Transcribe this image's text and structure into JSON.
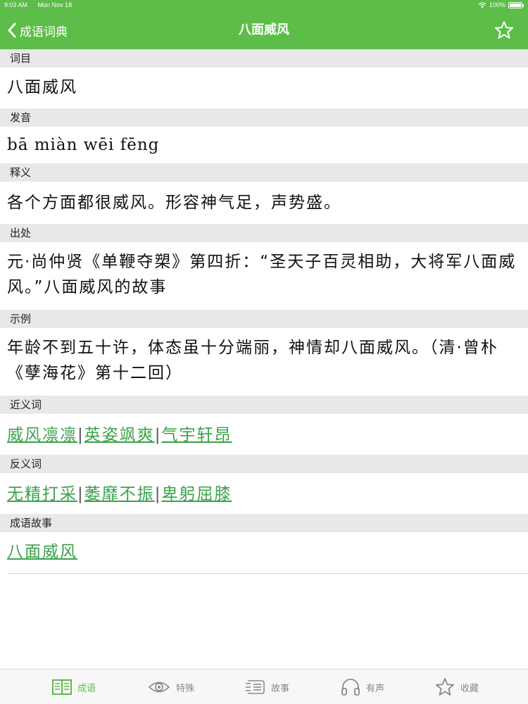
{
  "status": {
    "time": "9:03 AM",
    "date": "Mon Nov 18",
    "battery": "100%"
  },
  "nav": {
    "back_label": "成语词典",
    "title": "八面威风"
  },
  "sections": {
    "term": {
      "heading": "词目",
      "text": "八面威风"
    },
    "pinyin": {
      "heading": "发音",
      "text": "bā miàn wēi fēng"
    },
    "meaning": {
      "heading": "释义",
      "text": "各个方面都很威风。形容神气足，声势盛。"
    },
    "source": {
      "heading": "出处",
      "text": "元·尚仲贤《单鞭夺槊》第四折：“圣天子百灵相助，大将军八面威风。”八面威风的故事"
    },
    "example": {
      "heading": "示例",
      "text": "年龄不到五十许，体态虽十分端丽，神情却八面威风。（清·曾朴《孽海花》第十二回）"
    },
    "synonyms": {
      "heading": "近义词",
      "items": [
        "威风凛凛",
        "英姿飒爽",
        "气宇轩昂"
      ],
      "separator": "|"
    },
    "antonyms": {
      "heading": "反义词",
      "items": [
        "无精打采",
        "萎靡不振",
        "卑躬屈膝"
      ],
      "separator": "|"
    },
    "story": {
      "heading": "成语故事",
      "link": "八面威风"
    }
  },
  "tabs": [
    {
      "label": "成语",
      "icon": "book-icon",
      "active": true
    },
    {
      "label": "特殊",
      "icon": "eye-icon",
      "active": false
    },
    {
      "label": "故事",
      "icon": "list-icon",
      "active": false
    },
    {
      "label": "有声",
      "icon": "headphones-icon",
      "active": false
    },
    {
      "label": "收藏",
      "icon": "star-icon",
      "active": false
    }
  ],
  "colors": {
    "accent": "#5cbd48",
    "link": "#3aa24a",
    "section_bg": "#e8e8e8",
    "tab_inactive": "#8a8a8a"
  }
}
